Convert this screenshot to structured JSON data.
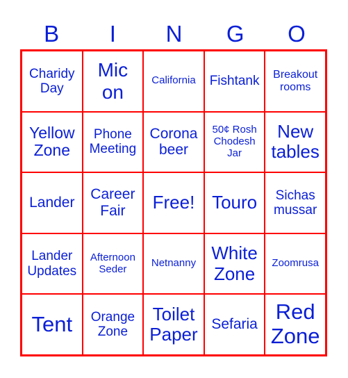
{
  "header": {
    "letters": [
      "B",
      "I",
      "N",
      "G",
      "O"
    ]
  },
  "colors": {
    "text": "#0a1fd6",
    "grid": "#ff0000",
    "background": "#ffffff"
  },
  "cells": [
    [
      "Charidy Day",
      "Mic on",
      "California",
      "Fishtank",
      "Breakout rooms"
    ],
    [
      "Yellow Zone",
      "Phone Meeting",
      "Corona beer",
      "50¢ Rosh Chodesh Jar",
      "New tables"
    ],
    [
      "Lander",
      "Career Fair",
      "Free!",
      "Touro",
      "Sichas mussar"
    ],
    [
      "Lander Updates",
      "Afternoon Seder",
      "Netnanny",
      "White Zone",
      "Zoomrusa"
    ],
    [
      "Tent",
      "Orange Zone",
      "Toilet Paper",
      "Sefaria",
      "Red Zone"
    ]
  ]
}
